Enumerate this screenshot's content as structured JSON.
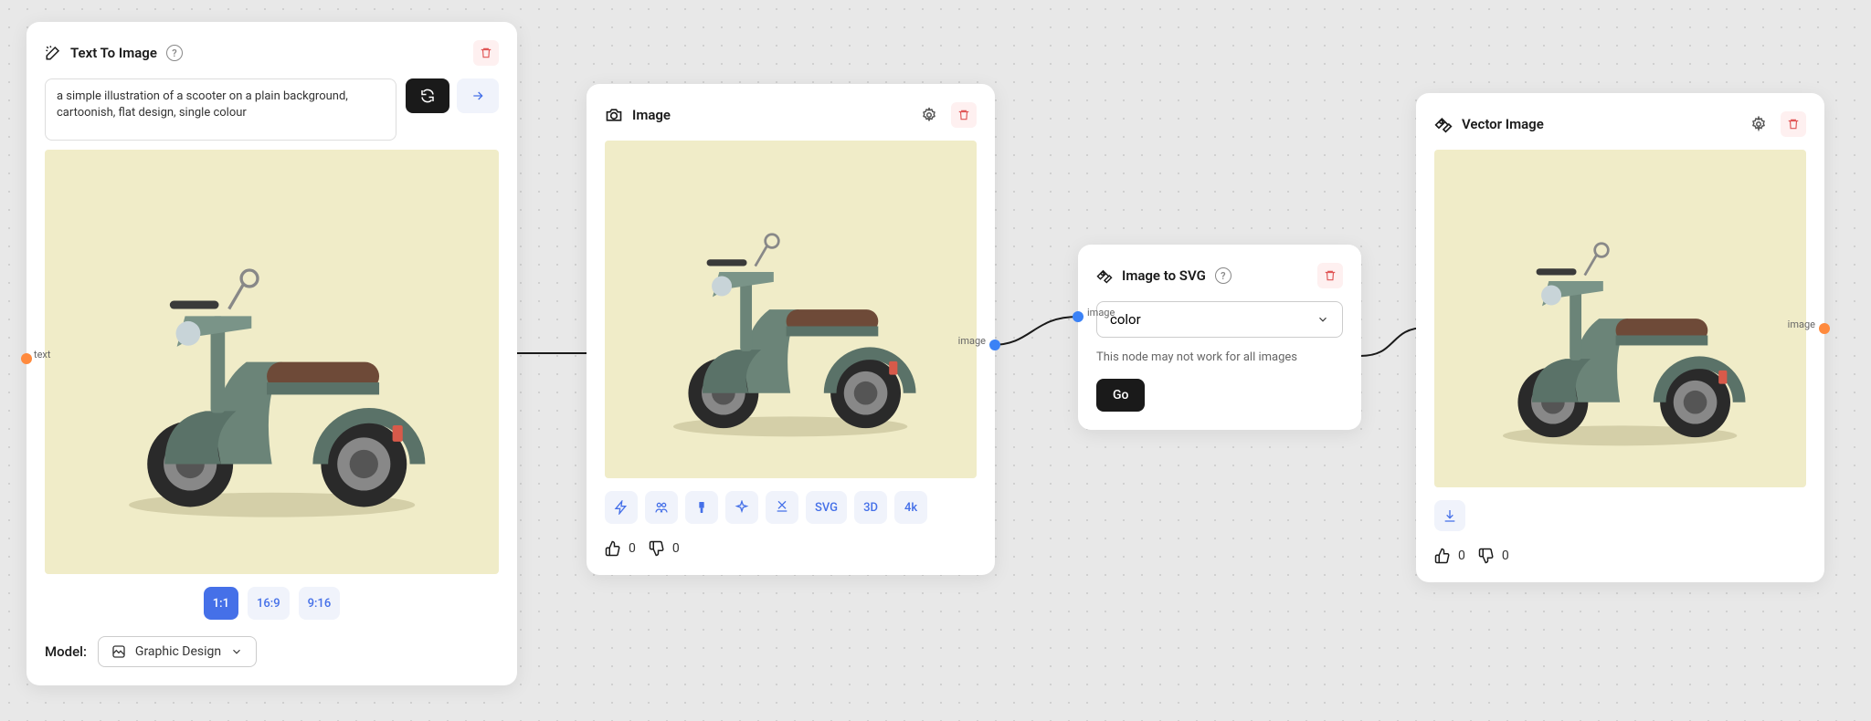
{
  "node1": {
    "title": "Text To Image",
    "prompt": "a simple illustration of a scooter on a plain background, cartoonish, flat design, single colour",
    "aspect": {
      "a": "1:1",
      "b": "16:9",
      "c": "9:16"
    },
    "model_label": "Model:",
    "model_value": "Graphic Design",
    "port_out": "text"
  },
  "node2": {
    "title": "Image",
    "actions": {
      "svg": "SVG",
      "threeD": "3D",
      "fourK": "4k"
    },
    "up": "0",
    "down": "0",
    "port_in": "image",
    "port_out": "image"
  },
  "node3": {
    "title": "Image to SVG",
    "mode": "color",
    "warn": "This node may not work for all images",
    "go": "Go",
    "port_in": "image",
    "port_out": "image"
  },
  "node4": {
    "title": "Vector Image",
    "up": "0",
    "down": "0",
    "port_out": "image"
  }
}
